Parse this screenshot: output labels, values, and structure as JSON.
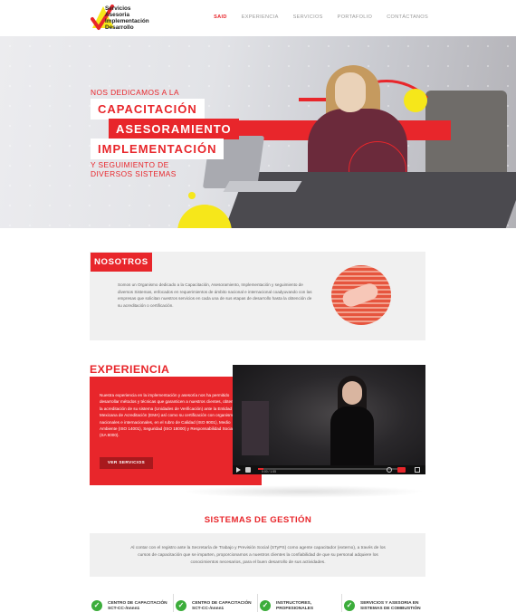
{
  "brand": {
    "logo_words": [
      "Servicios",
      "Asesoria",
      "Implementación",
      "Desarrollo"
    ],
    "accent": "#e8262b",
    "check_color": "#e8262b",
    "logo_yellow": "#f6e71a"
  },
  "nav": {
    "items": [
      {
        "label": "SAID",
        "active": true
      },
      {
        "label": "EXPERIENCIA",
        "active": false
      },
      {
        "label": "SERVICIOS",
        "active": false
      },
      {
        "label": "PORTAFOLIO",
        "active": false
      },
      {
        "label": "CONTÁCTANOS",
        "active": false
      }
    ]
  },
  "hero": {
    "lead": "NOS DEDICAMOS A LA",
    "tag1": "CAPACITACIÓN",
    "tag2": "ASESORAMIENTO",
    "tag3": "IMPLEMENTACIÓN",
    "sub": "Y SEGUIMIENTO DE DIVERSOS SISTEMAS"
  },
  "nosotros": {
    "title": "NOSOTROS",
    "text": "Somos un Organismo dedicado a la Capacitación, Asesoramiento, Implementación y seguimiento de diversos Sistemas, enfocados en requerimientos de ámbito nacional e internacional coadyuvando con las empresas que solicitan nuestros servicios en cada una de sus etapas de desarrollo hasta la obtención de su acreditación o certificación."
  },
  "experiencia": {
    "title": "EXPERIENCIA",
    "text": "Nuestra experiencia en la implementación y asesoría nos ha permitido desarrollar métodos y técnicas que garanticen a nuestros clientes, obtener la acreditación de su sistema (Unidades de Verificación) ante la Entidad Mexicana de Acreditación (EMA) así como su certificación con organismos nacionales e internacionales, en el rubro de Calidad (ISO 9001), Medio Ambiente (ISO 14001), Seguridad (ISO 18000) y Responsabilidad Social (SA 8000).",
    "button": "VER SERVICIOS",
    "video_time": "0:00 / 1:55"
  },
  "sistemas": {
    "title": "SISTEMAS DE GESTIÓN",
    "text": "Al contar con el registro ante la Secretaría de Trabajo y Previsión Social (STyPS) como agente capacitador (externo), a través de los cursos de capacitación que se imparten, proporcionamos a nuestros clientes la confiabilidad de que su personal adquiere los conocimientos necesarios, para el buen desarrollo de sus actividades.",
    "certs": [
      {
        "label": "CENTRO DE CAPACITACIÓN SCT-CC-/nnnn1"
      },
      {
        "label": "CENTRO DE CAPACITACIÓN SCT-CC-/nnnn1"
      },
      {
        "label": "INSTRUCTORES, PROFESIONALES ASOCIADOS"
      },
      {
        "label": "SERVICIOS Y ASESORIA EN SISTEMAS DE COMBUSTIÓN INTERNA S.A."
      }
    ],
    "tick_color": "#3cad3b"
  }
}
